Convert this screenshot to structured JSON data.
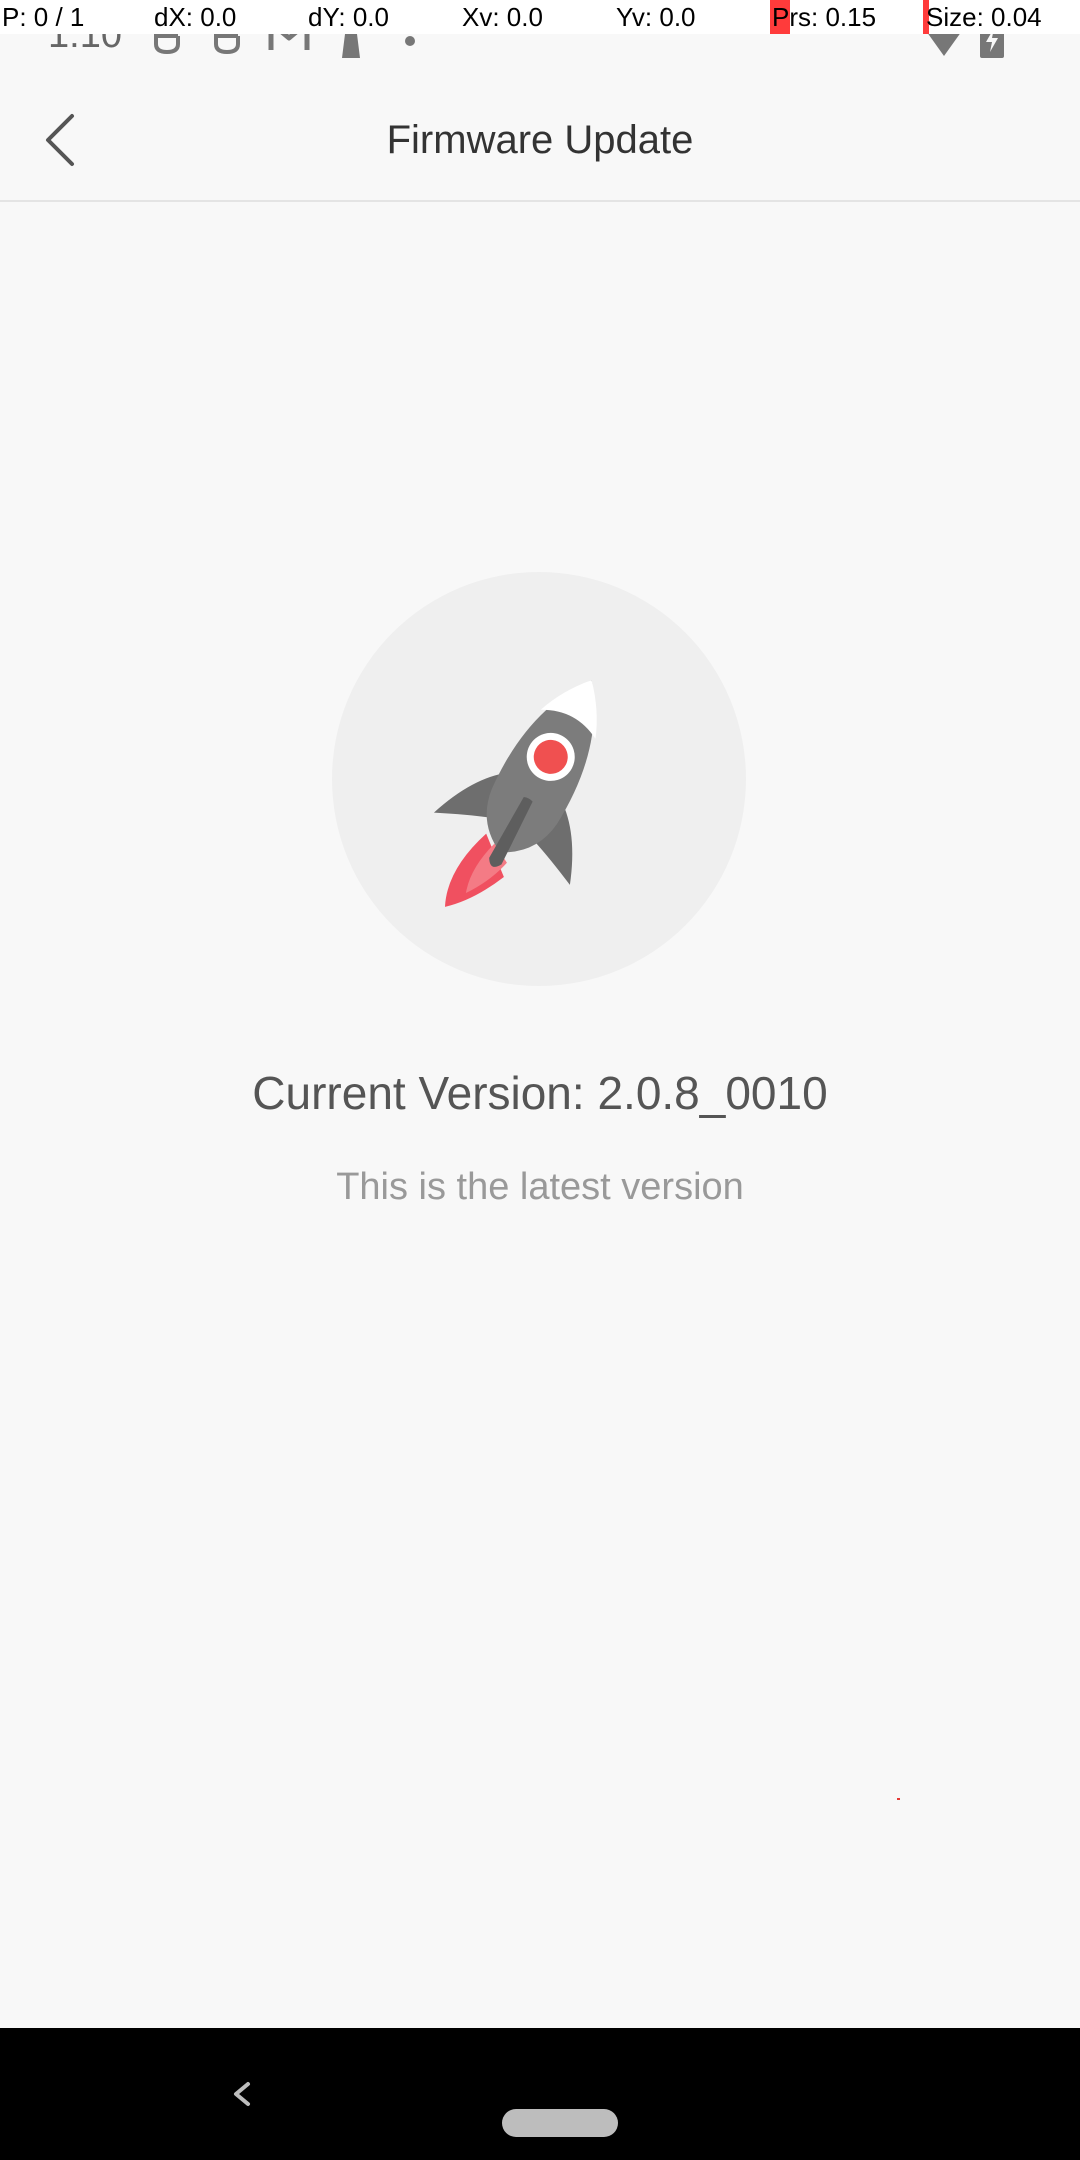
{
  "debug": {
    "pointer": "P: 0 / 1",
    "dx": "dX: 0.0",
    "dy": "dY: 0.0",
    "xv": "Xv: 0.0",
    "yv": "Yv: 0.0",
    "prs": "Prs: 0.15",
    "size": "Size: 0.04"
  },
  "status_bar": {
    "time": "1:10",
    "icons": [
      "notification-icon",
      "notification-icon",
      "gmail-icon",
      "person-icon",
      "dot-icon",
      "wifi-icon",
      "battery-charging-icon"
    ]
  },
  "app_bar": {
    "title": "Firmware Update",
    "back_icon": "chevron-left-icon"
  },
  "content": {
    "illustration": "rocket-icon",
    "current_version": "Current Version: 2.0.8_0010",
    "status_message": "This is the latest version"
  },
  "colors": {
    "accent_red": "#f05050",
    "rocket_gray": "#6e6e6e",
    "background": "#f8f8f8"
  },
  "nav_bar": {
    "back_icon": "nav-back-icon",
    "home_icon": "nav-home-pill"
  }
}
